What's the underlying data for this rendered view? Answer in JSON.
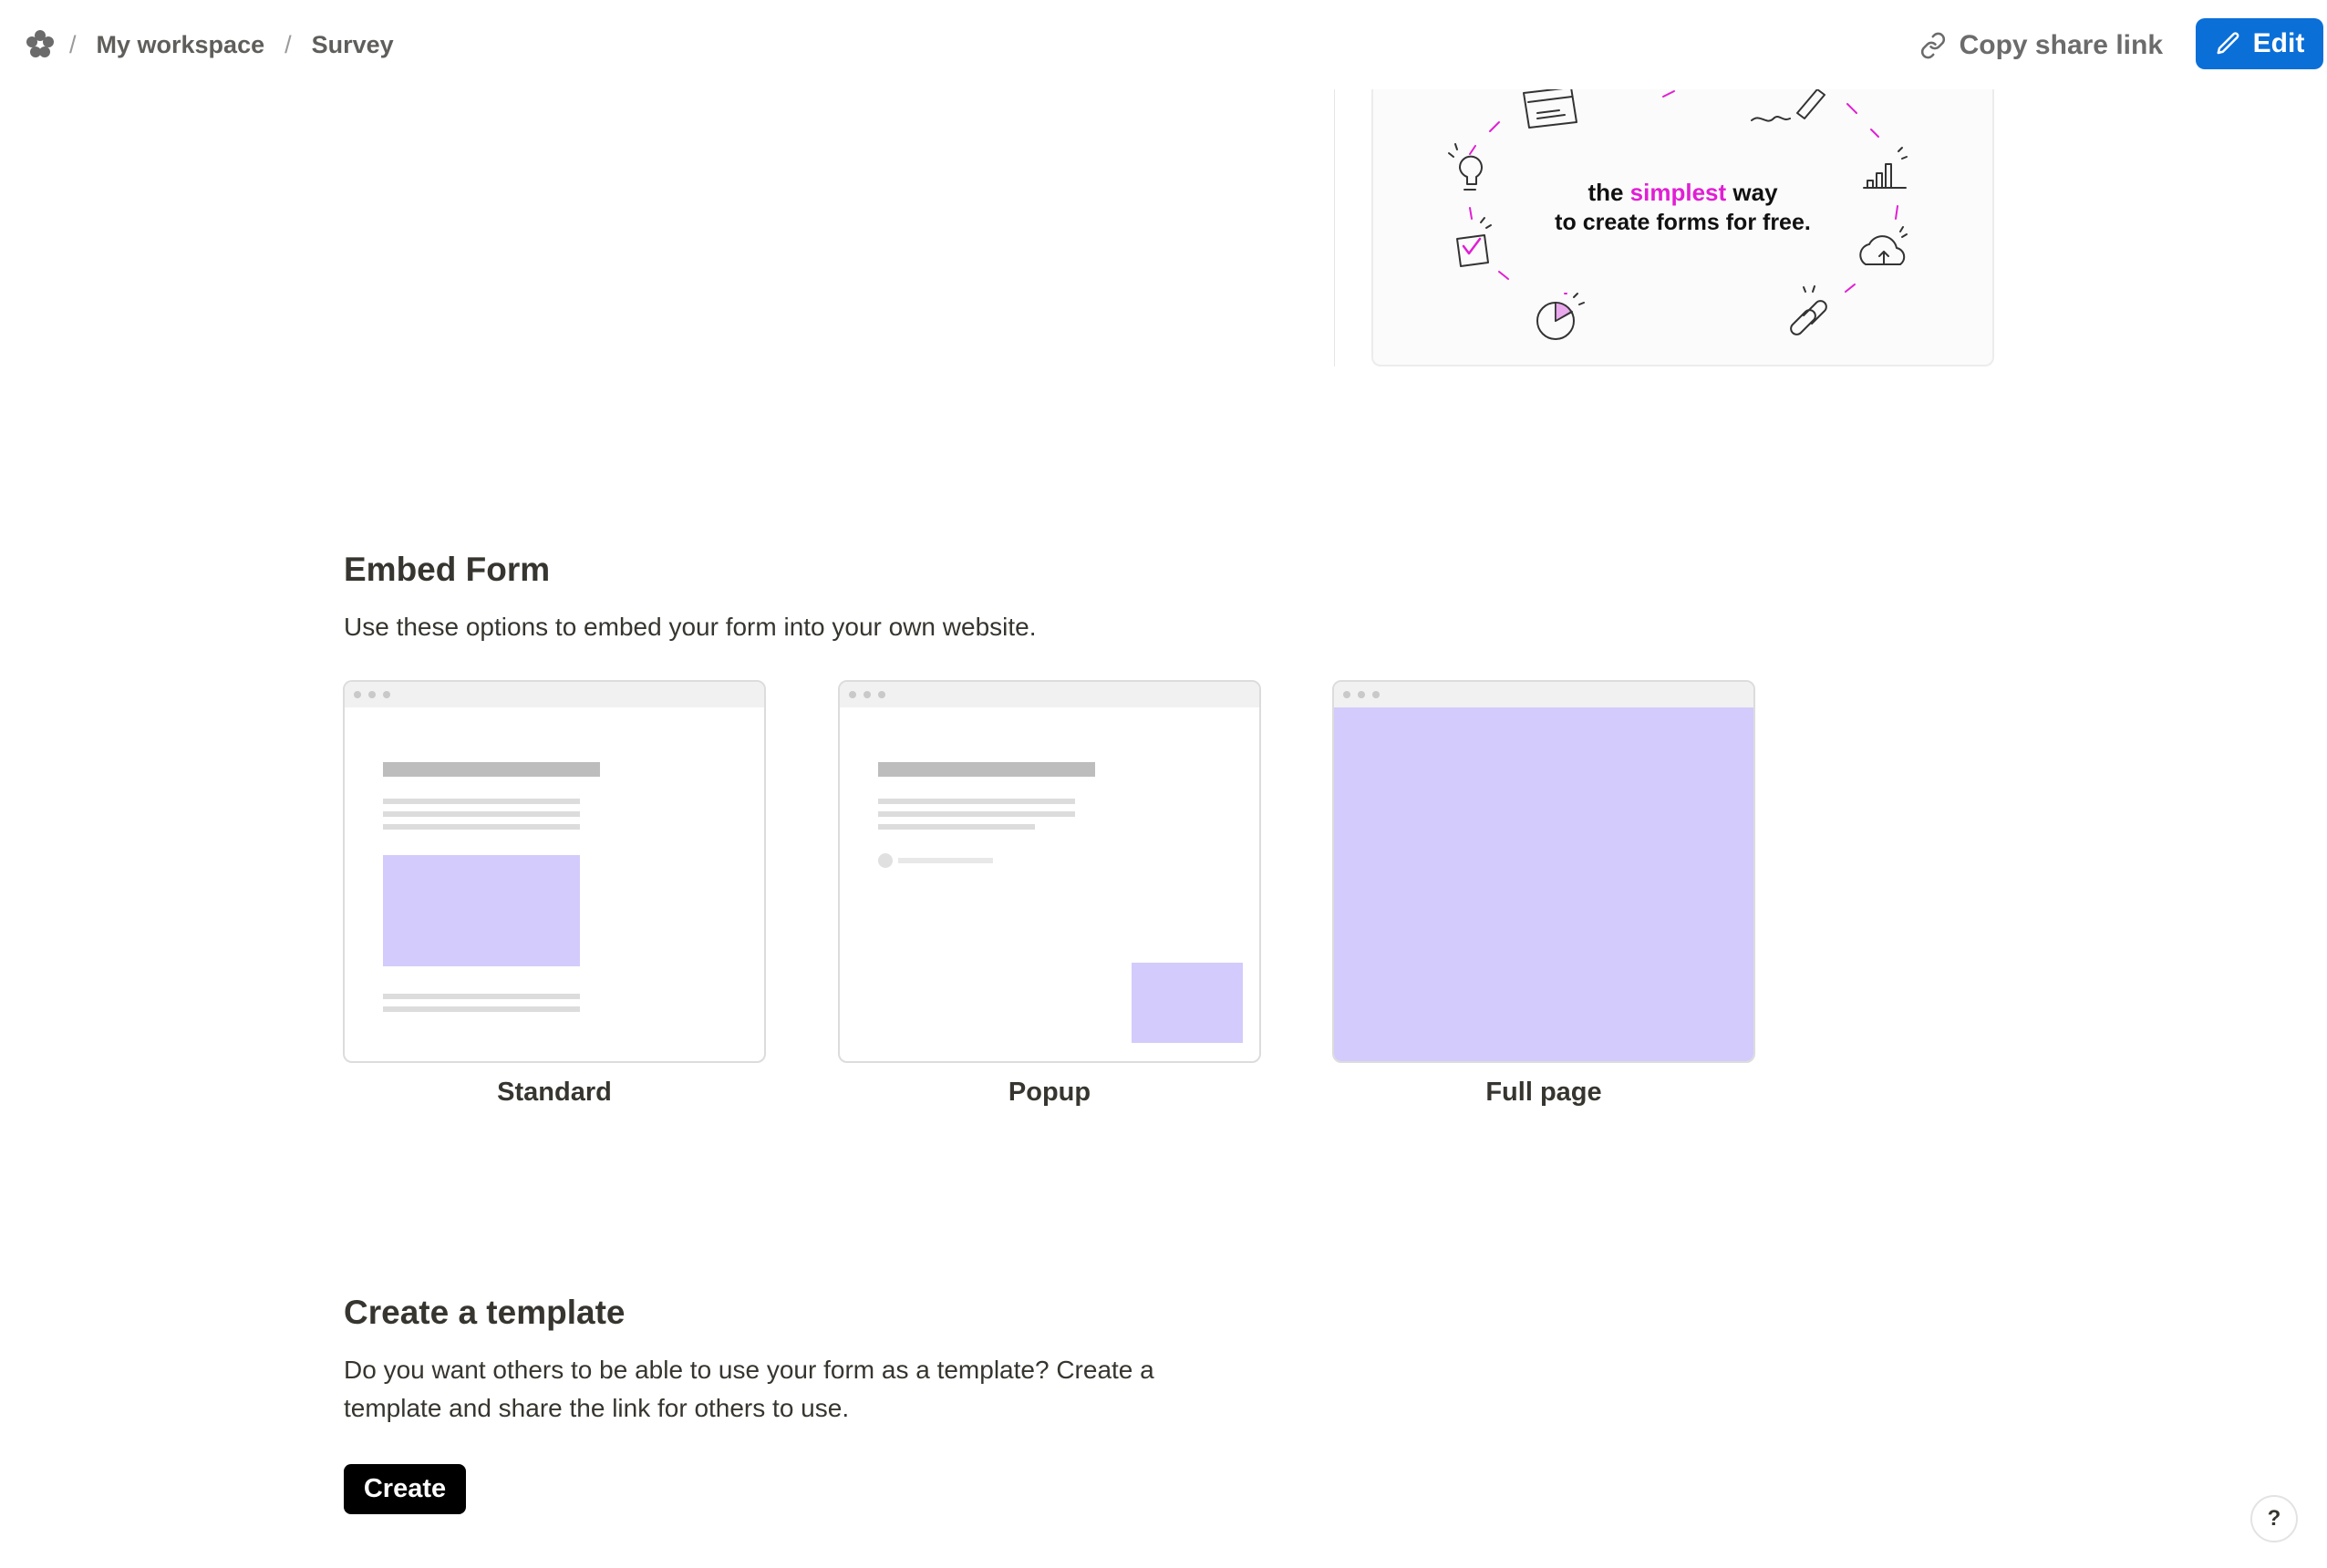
{
  "breadcrumb": {
    "separator": "/",
    "items": [
      "My workspace",
      "Survey"
    ]
  },
  "header": {
    "copy_share_link": "Copy share link",
    "edit_label": "Edit"
  },
  "banner": {
    "line1_prefix": "the",
    "line1_highlight": "simplest",
    "line1_suffix": "way",
    "line2": "to create forms for free."
  },
  "embed": {
    "title": "Embed Form",
    "description": "Use these options to embed your form into your own website.",
    "options": [
      "Standard",
      "Popup",
      "Full page"
    ]
  },
  "template": {
    "title": "Create a template",
    "description": "Do you want others to be able to use your form as a template? Create a template and share the link for others to use.",
    "button_label": "Create"
  },
  "help": {
    "label": "?"
  },
  "colors": {
    "accent": "#0b6fd8",
    "highlight": "#e01fd4",
    "preview_fill": "#d3cbfb"
  },
  "icons": [
    "workspace-logo-icon",
    "link-icon",
    "pencil-icon",
    "help-icon"
  ]
}
